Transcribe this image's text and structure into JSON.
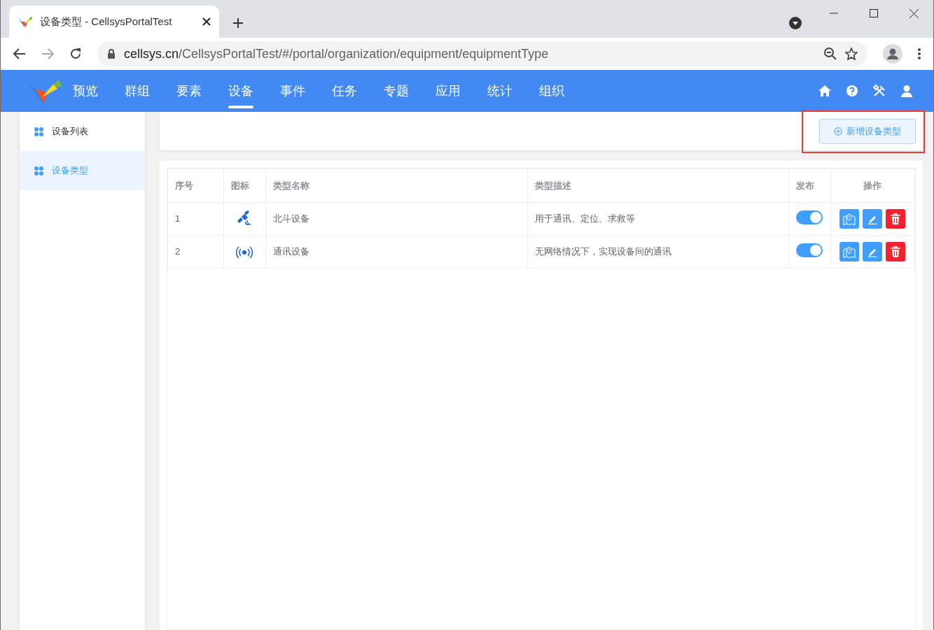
{
  "browser": {
    "tab_title": "设备类型 - CellsysPortalTest",
    "url_host": "cellsys.cn",
    "url_path": "/CellsysPortalTest/#/portal/organization/equipment/equipmentType"
  },
  "nav": {
    "items": [
      {
        "label": "预览",
        "selected": false
      },
      {
        "label": "群组",
        "selected": false
      },
      {
        "label": "要素",
        "selected": false
      },
      {
        "label": "设备",
        "selected": true
      },
      {
        "label": "事件",
        "selected": false
      },
      {
        "label": "任务",
        "selected": false
      },
      {
        "label": "专题",
        "selected": false
      },
      {
        "label": "应用",
        "selected": false
      },
      {
        "label": "统计",
        "selected": false
      },
      {
        "label": "组织",
        "selected": false
      }
    ]
  },
  "sidebar": {
    "items": [
      {
        "label": "设备列表",
        "selected": false
      },
      {
        "label": "设备类型",
        "selected": true
      }
    ]
  },
  "toolbar": {
    "add_button": {
      "label": "新增设备类型",
      "highlighted": true
    }
  },
  "table": {
    "columns": [
      "序号",
      "图标",
      "类型名称",
      "类型描述",
      "发布",
      "操作"
    ],
    "rows": [
      {
        "index": "1",
        "kind": "satellite",
        "name": "北斗设备",
        "description": "用于通讯、定位、求救等",
        "published": true
      },
      {
        "index": "2",
        "kind": "signal",
        "name": "通讯设备",
        "description": "无网络情况下，实现设备间的通讯",
        "published": true
      }
    ]
  }
}
